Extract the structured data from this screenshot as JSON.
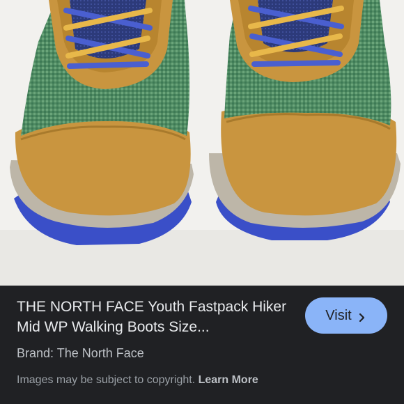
{
  "result": {
    "title": "THE NORTH FACE Youth Fastpack Hiker Mid WP Walking Boots Size...",
    "brand": "Brand: The North Face",
    "visit_label": "Visit",
    "copyright_text": "Images may be subject to copyright.",
    "learn_more_label": "Learn More"
  },
  "image": {
    "icon": "chevron-right-icon"
  },
  "colors": {
    "panel_bg": "#202124",
    "visit_button_bg": "#8ab4f8",
    "title_text": "#e8eaed",
    "shoe_tan": "#c9953f",
    "shoe_green": "#4f8a62",
    "sole_blue": "#3a4fc8",
    "lace_blue": "#4a5fd0",
    "lace_yellow": "#e8b84a"
  }
}
